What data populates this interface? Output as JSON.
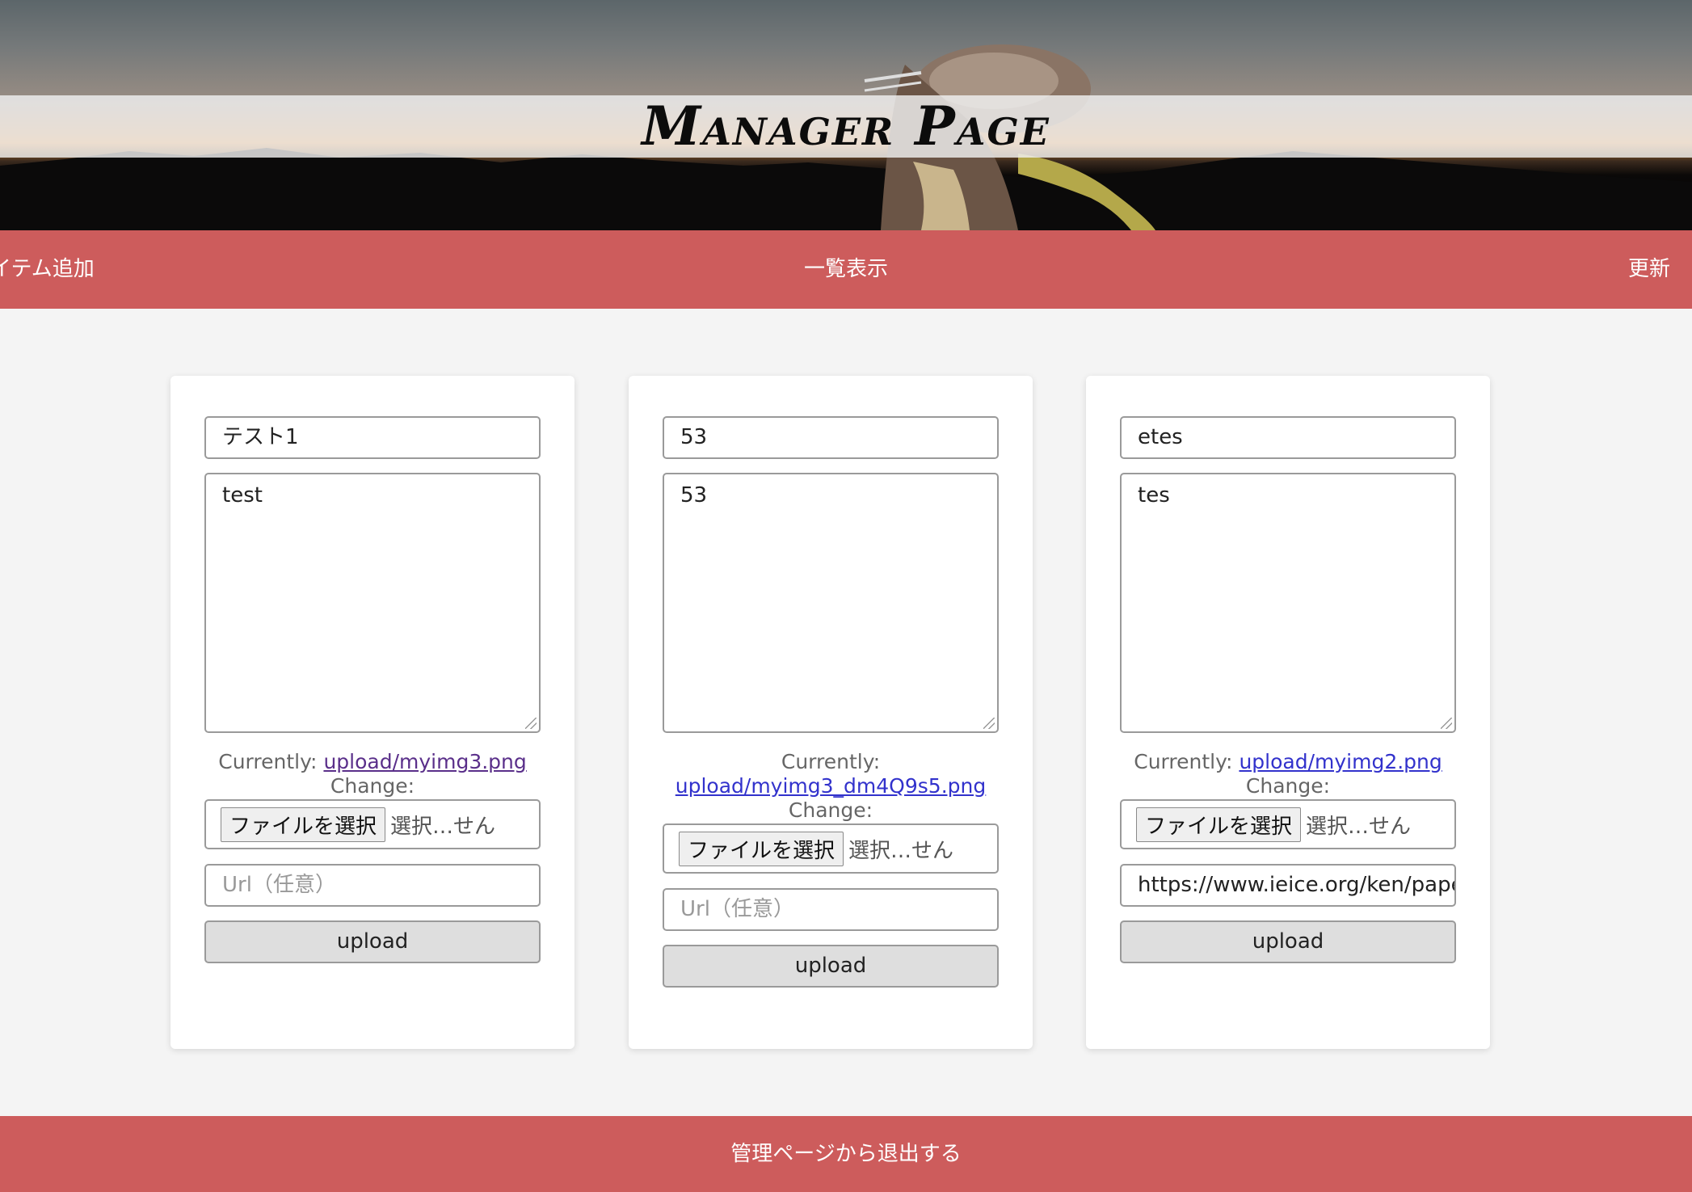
{
  "header": {
    "title": "Manager Page"
  },
  "nav": {
    "add_item": "イテム追加",
    "list_view": "一覧表示",
    "update": "更新"
  },
  "cards": [
    {
      "title": "テスト1",
      "description": "test",
      "currently_label": "Currently:",
      "current_file": "upload/myimg3.png",
      "change_label": "Change:",
      "file_button": "ファイルを選択",
      "file_status": "選択…せん",
      "url_placeholder": "Url（任意）",
      "url_value": "",
      "upload_label": "upload"
    },
    {
      "title": "53",
      "description": "53",
      "currently_label": "Currently:",
      "current_file": "upload/myimg3_dm4Q9s5.png",
      "change_label": "Change:",
      "file_button": "ファイルを選択",
      "file_status": "選択…せん",
      "url_placeholder": "Url（任意）",
      "url_value": "",
      "upload_label": "upload"
    },
    {
      "title": "etes",
      "description": "tes",
      "currently_label": "Currently:",
      "current_file": "upload/myimg2.png",
      "change_label": "Change:",
      "file_button": "ファイルを選択",
      "file_status": "選択…せん",
      "url_placeholder": "Url（任意）",
      "url_value": "https://www.ieice.org/ken/paper",
      "upload_label": "upload"
    }
  ],
  "footer": {
    "logout": "管理ページから退出する"
  },
  "colors": {
    "accent": "#cd5c5c",
    "background": "#f4f4f4",
    "link": "#3232cc",
    "visited_link": "#5a2f8a"
  }
}
